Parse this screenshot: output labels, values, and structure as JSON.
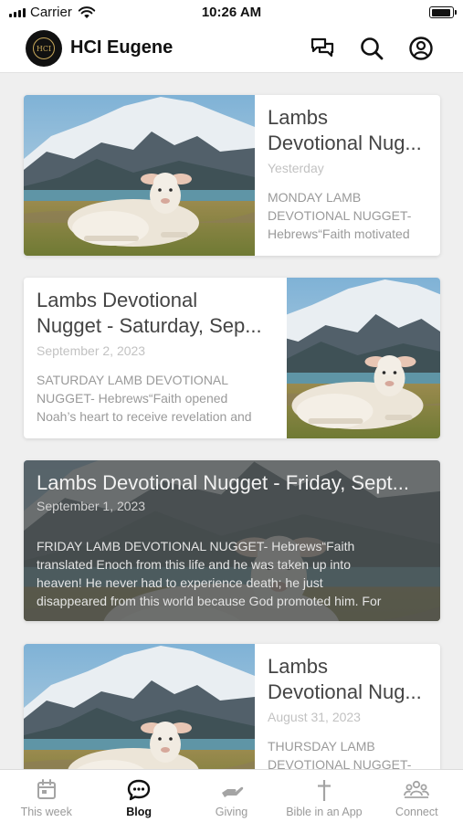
{
  "status_bar": {
    "carrier": "Carrier",
    "time": "10:26 AM",
    "battery_level": 0.95
  },
  "header": {
    "app_title": "HCI Eugene",
    "logo_text": "HCI"
  },
  "posts": [
    {
      "title_line1": "Lambs",
      "title_line2": "Devotional Nug...",
      "date": "Yesterday",
      "excerpt_line1": "MONDAY LAMB",
      "excerpt_line2": "DEVOTIONAL NUGGET-",
      "excerpt_line3": "Hebrews“Faith motivated",
      "image": "lamb-mountain-photo"
    },
    {
      "title_line1": "Lambs Devotional",
      "title_line2": "Nugget - Saturday, Sep...",
      "date": "September 2, 2023",
      "excerpt_line1": "SATURDAY LAMB DEVOTIONAL",
      "excerpt_line2": "NUGGET- Hebrews“Faith opened",
      "excerpt_line3": "Noah’s heart to receive revelation and",
      "image": "lamb-mountain-photo"
    },
    {
      "title_line1": "Lambs Devotional Nugget - Friday, Sept...",
      "date": "September 1, 2023",
      "excerpt_line1": "FRIDAY LAMB DEVOTIONAL NUGGET- Hebrews“Faith",
      "excerpt_line2": "translated Enoch from this life and he was taken up into",
      "excerpt_line3": "heaven! He never had to experience death; he just",
      "excerpt_line4": "disappeared from this world because God promoted him. For",
      "image": "lamb-mountain-photo"
    },
    {
      "title_line1": "Lambs",
      "title_line2": "Devotional Nug...",
      "date": "August 31, 2023",
      "excerpt_line1": "THURSDAY LAMB",
      "excerpt_line2": "DEVOTIONAL NUGGET-",
      "image": "lamb-mountain-photo"
    }
  ],
  "tabs": [
    {
      "label": "This week",
      "icon": "calendar-icon",
      "active": false
    },
    {
      "label": "Blog",
      "icon": "chat-bubble-icon",
      "active": true
    },
    {
      "label": "Giving",
      "icon": "hand-icon",
      "active": false
    },
    {
      "label": "Bible in an App",
      "icon": "cross-icon",
      "active": false
    },
    {
      "label": "Connect",
      "icon": "people-icon",
      "active": false
    }
  ]
}
